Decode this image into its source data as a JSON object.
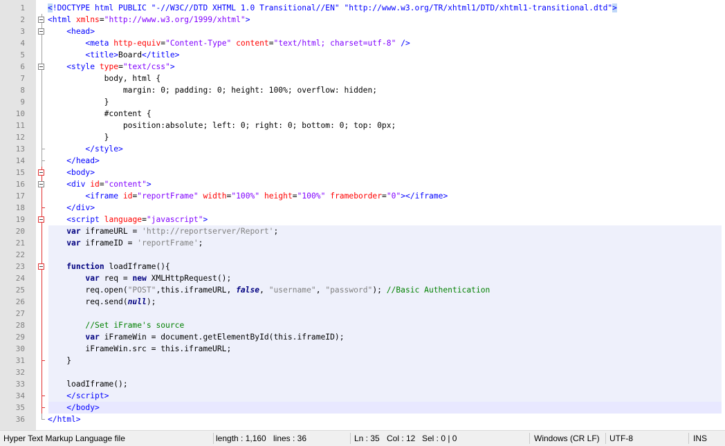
{
  "editor": {
    "lines": [
      {
        "n": "1",
        "html": "<span class=\"tag sel\">&lt;</span><span class=\"tag\">!DOCTYPE html PUBLIC \"-//W3C//DTD XHTML 1.0 Transitional//EN\" \"http://www.w3.org/TR/xhtml1/DTD/xhtml1-transitional.dtd\"</span><span class=\"tag sel\">&gt;</span>"
      },
      {
        "n": "2",
        "html": "<span class=\"tag\">&lt;html</span> <span class=\"attr\">xmlns</span><span class=\"blk\">=</span><span class=\"val\">\"http://www.w3.org/1999/xhtml\"</span><span class=\"tag\">&gt;</span>"
      },
      {
        "n": "3",
        "html": "    <span class=\"tag\">&lt;head&gt;</span>"
      },
      {
        "n": "4",
        "html": "        <span class=\"tag\">&lt;meta</span> <span class=\"attr\">http-equiv</span>=<span class=\"val\">\"Content-Type\"</span> <span class=\"attr\">content</span>=<span class=\"val\">\"text/html; charset=utf-8\"</span> <span class=\"tag\">/&gt;</span>"
      },
      {
        "n": "5",
        "html": "        <span class=\"tag\">&lt;title&gt;</span>Board<span class=\"tag\">&lt;/title&gt;</span>"
      },
      {
        "n": "6",
        "html": "    <span class=\"tag\">&lt;style</span> <span class=\"attr\">type</span>=<span class=\"val\">\"text/css\"</span><span class=\"tag\">&gt;</span>"
      },
      {
        "n": "7",
        "html": "            body, html {"
      },
      {
        "n": "8",
        "html": "                margin: 0; padding: 0; height: 100%; overflow: hidden;"
      },
      {
        "n": "9",
        "html": "            }"
      },
      {
        "n": "10",
        "html": "            #content {"
      },
      {
        "n": "11",
        "html": "                position:absolute; left: 0; right: 0; bottom: 0; top: 0px;"
      },
      {
        "n": "12",
        "html": "            }"
      },
      {
        "n": "13",
        "html": "        <span class=\"tag\">&lt;/style&gt;</span>"
      },
      {
        "n": "14",
        "html": "    <span class=\"tag\">&lt;/head&gt;</span>"
      },
      {
        "n": "15",
        "html": "    <span class=\"tag\">&lt;body&gt;</span>"
      },
      {
        "n": "16",
        "html": "    <span class=\"tag\">&lt;div</span> <span class=\"attr\">id</span>=<span class=\"val\">\"content\"</span><span class=\"tag\">&gt;</span>"
      },
      {
        "n": "17",
        "html": "        <span class=\"tag\">&lt;iframe</span> <span class=\"attr\">id</span>=<span class=\"val\">\"reportFrame\"</span> <span class=\"attr\">width</span>=<span class=\"val\">\"100%\"</span> <span class=\"attr\">height</span>=<span class=\"val\">\"100%\"</span> <span class=\"attr\">frameborder</span>=<span class=\"val\">\"0\"</span><span class=\"tag\">&gt;&lt;/iframe&gt;</span>"
      },
      {
        "n": "18",
        "html": "    <span class=\"tag\">&lt;/div&gt;</span>"
      },
      {
        "n": "19",
        "html": "    <span class=\"tag\">&lt;script</span> <span class=\"attr\">language</span>=<span class=\"val\">\"javascript\"</span><span class=\"tag\">&gt;</span>"
      },
      {
        "n": "20",
        "html": "    <span class=\"kw\">var</span> iframeURL = <span class=\"str\">'http://reportserver/Report'</span>;"
      },
      {
        "n": "21",
        "html": "    <span class=\"kw\">var</span> iframeID = <span class=\"str\">'reportFrame'</span>;"
      },
      {
        "n": "22",
        "html": ""
      },
      {
        "n": "23",
        "html": "    <span class=\"kw\">function</span> loadIframe(){"
      },
      {
        "n": "24",
        "html": "        <span class=\"kw\">var</span> req = <span class=\"kw\">new</span> XMLHttpRequest();"
      },
      {
        "n": "25",
        "html": "        req.open(<span class=\"str\">\"POST\"</span>,this.iframeURL, <span class=\"kwi\">false</span>, <span class=\"str\">\"username\"</span>, <span class=\"str\">\"password\"</span>); <span class=\"cmt\">//Basic Authentication</span>"
      },
      {
        "n": "26",
        "html": "        req.send(<span class=\"kwi\">null</span>);"
      },
      {
        "n": "27",
        "html": ""
      },
      {
        "n": "28",
        "html": "        <span class=\"cmt\">//Set iFrame's source</span>"
      },
      {
        "n": "29",
        "html": "        <span class=\"kw\">var</span> iFrameWin = document.getElementById(this.iframeID);"
      },
      {
        "n": "30",
        "html": "        iFrameWin.src = this.iframeURL;"
      },
      {
        "n": "31",
        "html": "    }"
      },
      {
        "n": "32",
        "html": ""
      },
      {
        "n": "33",
        "html": "    loadIframe();"
      },
      {
        "n": "34",
        "html": "    <span class=\"tag\">&lt;/script&gt;</span>"
      },
      {
        "n": "35",
        "html": "    <span class=\"tag\">&lt;/body&gt;</span>"
      },
      {
        "n": "36",
        "html": "<span class=\"tag\">&lt;/html&gt;</span>"
      }
    ]
  },
  "status": {
    "file_type": "Hyper Text Markup Language file",
    "length": "length : 1,160",
    "lines": "lines : 36",
    "ln": "Ln : 35",
    "col": "Col : 12",
    "sel": "Sel : 0 | 0",
    "eol": "Windows (CR LF)",
    "encoding": "UTF-8",
    "mode": "INS"
  }
}
